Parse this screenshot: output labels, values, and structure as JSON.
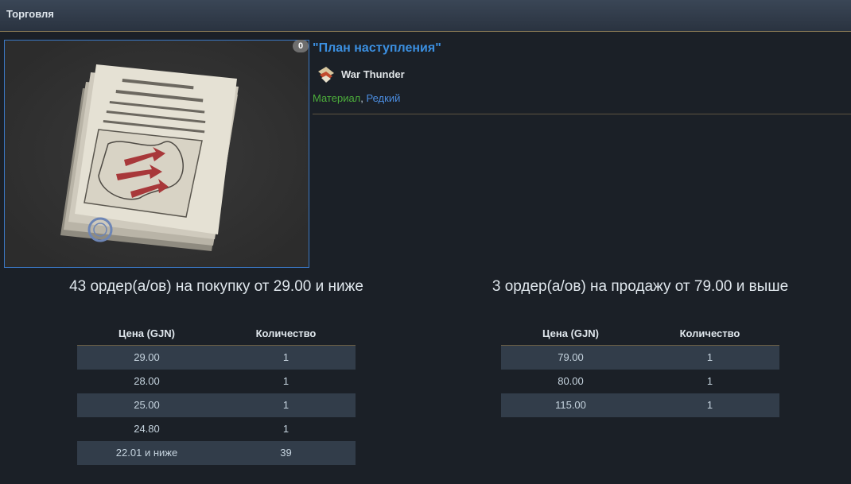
{
  "header": {
    "title": "Торговля"
  },
  "item": {
    "count_badge": "0",
    "name": "\"План наступления\"",
    "game": "War Thunder",
    "tag_material": "Материал",
    "tag_separator": ", ",
    "tag_rarity": "Редкий"
  },
  "buy_orders": {
    "summary": "43 ордер(а/ов) на покупку от 29.00 и ниже",
    "col_price": "Цена (GJN)",
    "col_qty": "Количество",
    "rows": [
      {
        "price": "29.00",
        "qty": "1"
      },
      {
        "price": "28.00",
        "qty": "1"
      },
      {
        "price": "25.00",
        "qty": "1"
      },
      {
        "price": "24.80",
        "qty": "1"
      },
      {
        "price": "22.01 и ниже",
        "qty": "39"
      }
    ]
  },
  "sell_orders": {
    "summary": "3 ордер(а/ов) на продажу от 79.00 и выше",
    "col_price": "Цена (GJN)",
    "col_qty": "Количество",
    "rows": [
      {
        "price": "79.00",
        "qty": "1"
      },
      {
        "price": "80.00",
        "qty": "1"
      },
      {
        "price": "115.00",
        "qty": "1"
      }
    ]
  }
}
